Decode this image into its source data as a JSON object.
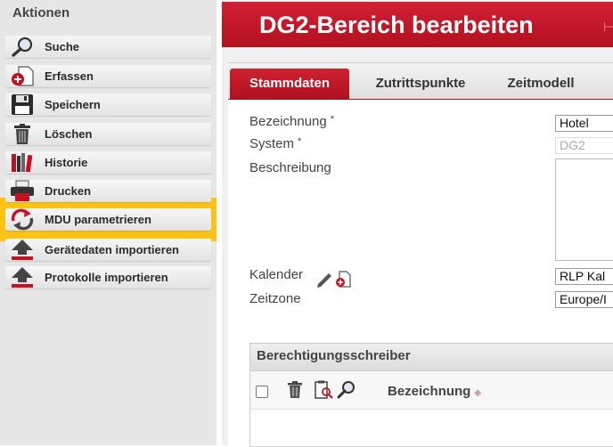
{
  "sidebar": {
    "heading": "Aktionen",
    "items": [
      {
        "label": "Suche",
        "icon": "search-icon"
      },
      {
        "label": "Erfassen",
        "icon": "add-document-icon"
      },
      {
        "label": "Speichern",
        "icon": "save-icon"
      },
      {
        "label": "Löschen",
        "icon": "trash-icon"
      },
      {
        "label": "Historie",
        "icon": "history-books-icon"
      },
      {
        "label": "Drucken",
        "icon": "printer-icon"
      },
      {
        "label": "MDU parametrieren",
        "icon": "refresh-arrows-icon",
        "highlighted": true
      },
      {
        "label": "Gerätedaten importieren",
        "icon": "upload-arrow-icon"
      },
      {
        "label": "Protokolle importieren",
        "icon": "upload-arrow-icon"
      }
    ]
  },
  "header": {
    "title": "DG2-Bereich bearbeiten"
  },
  "tabs": [
    {
      "label": "Stammdaten",
      "active": true
    },
    {
      "label": "Zutrittspunkte",
      "active": false
    },
    {
      "label": "Zeitmodell",
      "active": false
    }
  ],
  "form": {
    "bezeichnung": {
      "label": "Bezeichnung",
      "required": "*",
      "value": "Hotel"
    },
    "system": {
      "label": "System",
      "required": "*",
      "value": "DG2"
    },
    "beschreibung": {
      "label": "Beschreibung",
      "value": ""
    },
    "kalender": {
      "label": "Kalender",
      "value": "RLP Kal"
    },
    "zeitzone": {
      "label": "Zeitzone",
      "value": "Europe/I"
    }
  },
  "panel": {
    "title": "Berechtigungsschreiber",
    "column": "Bezeichnung",
    "sort_glyph": "◆"
  },
  "colors": {
    "accent": "#b3111f",
    "highlight": "#fcc314"
  }
}
